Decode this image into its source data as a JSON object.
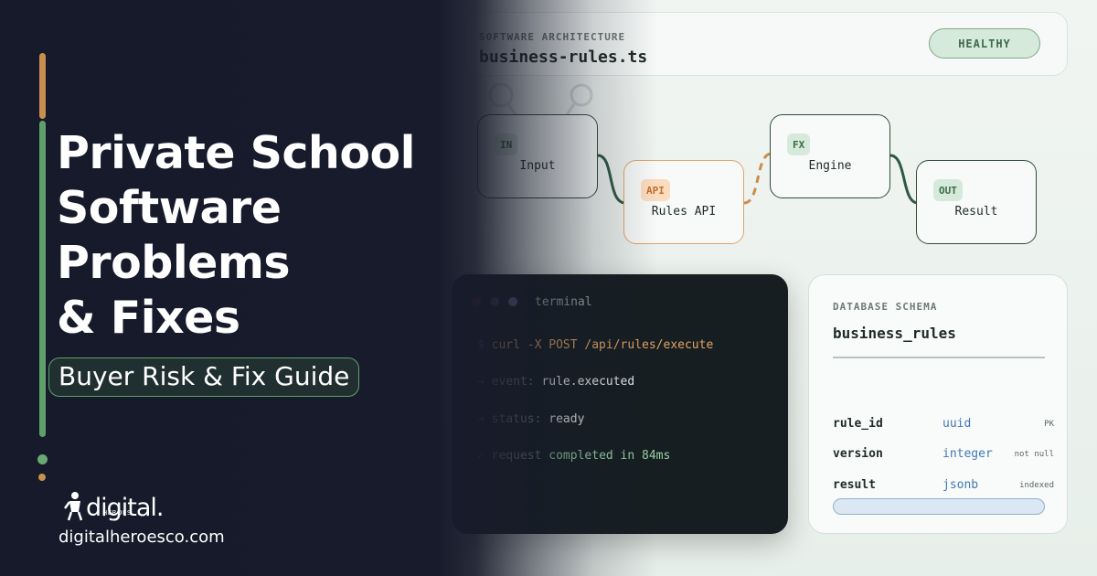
{
  "hero": {
    "headline": [
      "Private School",
      "Software",
      "Problems",
      "& Fixes"
    ],
    "subtitle": "Buyer Risk & Fix Guide"
  },
  "brand": {
    "logo_text": "digital.",
    "logo_sub": "HEROES",
    "website": "digitalheroesco.com"
  },
  "header": {
    "label": "SOFTWARE ARCHITECTURE",
    "file": "business-rules.ts",
    "status": "HEALTHY"
  },
  "flow": {
    "nodes": [
      {
        "tag": "IN",
        "label": "Input"
      },
      {
        "tag": "API",
        "label": "Rules API"
      },
      {
        "tag": "FX",
        "label": "Engine"
      },
      {
        "tag": "OUT",
        "label": "Result"
      }
    ]
  },
  "terminal": {
    "title": "terminal",
    "lines": [
      {
        "prefix": "$ ",
        "text": "curl -X POST /api/rules/execute"
      },
      {
        "prefix": "→ ",
        "key": "event: ",
        "value": "rule.executed"
      },
      {
        "prefix": "→ ",
        "key": "status: ",
        "value": "ready"
      },
      {
        "prefix": "✓ ",
        "key": "request ",
        "value": "completed in 84ms"
      }
    ]
  },
  "schema": {
    "label": "DATABASE SCHEMA",
    "table": "business_rules",
    "rows": [
      {
        "column": "rule_id",
        "type": "uuid",
        "flag": "PK"
      },
      {
        "column": "version",
        "type": "integer",
        "flag": "not null"
      },
      {
        "column": "result",
        "type": "jsonb",
        "flag": "indexed"
      }
    ]
  },
  "colors": {
    "accent_green": "#5fa06a",
    "accent_orange": "#c98f4e",
    "dark_bg": "#171b2b",
    "terminal_bg": "#161e22"
  }
}
